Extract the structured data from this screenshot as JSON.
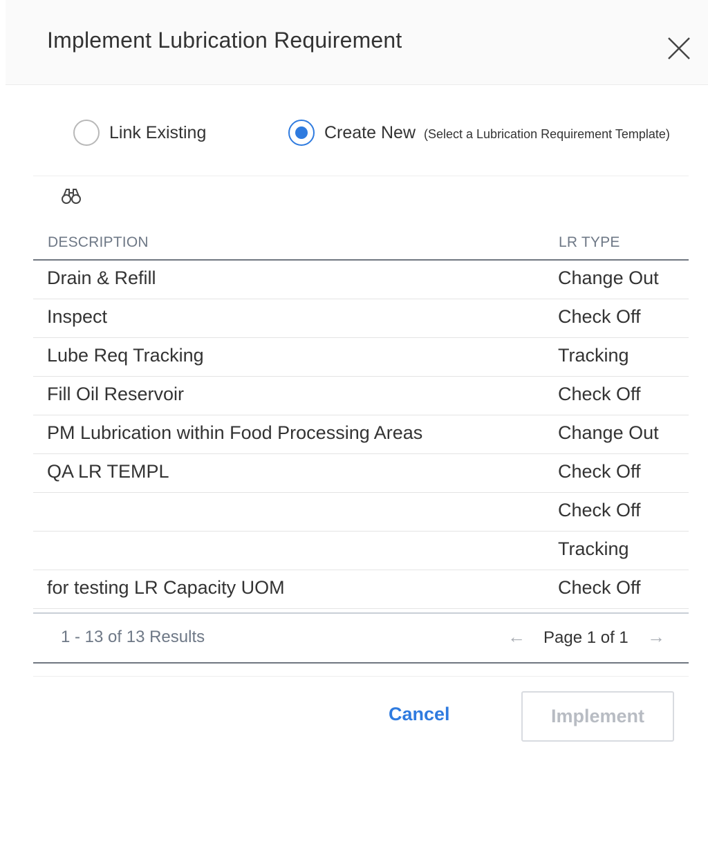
{
  "dialog": {
    "title": "Implement Lubrication Requirement"
  },
  "radio_options": {
    "link_existing": {
      "label": "Link Existing",
      "selected": false
    },
    "create_new": {
      "label": "Create New",
      "hint": "(Select a Lubrication Requirement Template)",
      "selected": true
    }
  },
  "icons": {
    "close": "close-icon",
    "search": "binoculars-icon",
    "prev": "arrow-left-icon",
    "next": "arrow-right-icon"
  },
  "table": {
    "columns": [
      "DESCRIPTION",
      "LR TYPE"
    ],
    "rows": [
      {
        "description": "Drain & Refill",
        "type": "Change Out"
      },
      {
        "description": "Inspect",
        "type": "Check Off"
      },
      {
        "description": "Lube Req Tracking",
        "type": "Tracking"
      },
      {
        "description": "Fill Oil Reservoir",
        "type": "Check Off"
      },
      {
        "description": "PM Lubrication within Food Processing Areas",
        "type": "Change Out"
      },
      {
        "description": "QA LR TEMPL",
        "type": "Check Off"
      },
      {
        "description": "",
        "type": "Check Off"
      },
      {
        "description": "",
        "type": "Tracking"
      },
      {
        "description": "for testing LR Capacity UOM",
        "type": "Check Off"
      }
    ]
  },
  "pager": {
    "results": "1 - 13 of 13 Results",
    "page": "Page 1 of 1"
  },
  "footer": {
    "cancel_label": "Cancel",
    "implement_label": "Implement"
  },
  "colors": {
    "accent": "#2f7bdf",
    "muted": "#6e7886",
    "disabled": "#b8bcc3"
  }
}
